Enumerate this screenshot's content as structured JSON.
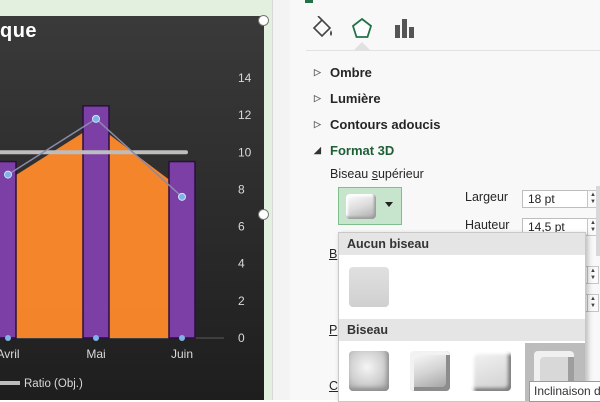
{
  "chart": {
    "title_fragment": "que",
    "y_ticks": [
      "14",
      "12",
      "10",
      "8",
      "6",
      "4",
      "2",
      "0"
    ],
    "x_labels": [
      "Avril",
      "Mai",
      "Juin"
    ],
    "legend_label": "Ratio (Obj.)"
  },
  "chart_data": {
    "type": "bar",
    "categories": [
      "Avril",
      "Mai",
      "Juin"
    ],
    "ylim": [
      0,
      14
    ],
    "series": [
      {
        "name": "",
        "type": "bar",
        "values": [
          9.5,
          12.5,
          9.5
        ],
        "color": "#7b3fa6"
      },
      {
        "name": "",
        "type": "area",
        "values": [
          8.5,
          11.5,
          8.0
        ],
        "color": "#ff8a2a"
      },
      {
        "name": "",
        "type": "line",
        "values": [
          8.8,
          11.8,
          7.6
        ],
        "color": "#8a8aa8"
      },
      {
        "name": "Ratio (Obj.)",
        "type": "line",
        "values": [
          10,
          10,
          10
        ],
        "color": "#bdbdbd"
      }
    ]
  },
  "pane": {
    "tabs": [
      {
        "name": "fill-line-tab",
        "icon": "paint-bucket-icon"
      },
      {
        "name": "effects-tab",
        "icon": "pentagon-icon"
      },
      {
        "name": "series-options-tab",
        "icon": "bar-chart-icon"
      }
    ],
    "sections": [
      "Ombre",
      "Lumière",
      "Contours adoucis",
      "Format 3D"
    ],
    "top_bevel_label_pre": "Biseau ",
    "top_bevel_label_underlined": "s",
    "top_bevel_label_post": "upérieur",
    "width_label": "Largeur",
    "width_value": "18 pt",
    "height_label": "Hauteur",
    "height_value": "14,5 pt",
    "clipped_b": "B",
    "clipped_p": "P",
    "clipped_c": "C"
  },
  "dropdown": {
    "no_bevel_header": "Aucun biseau",
    "bevel_header": "Biseau",
    "tooltip": "Inclinaison d"
  },
  "colors": {
    "accent": "#217346",
    "bar": "#7b3fa6",
    "area": "#ff8a2a"
  }
}
